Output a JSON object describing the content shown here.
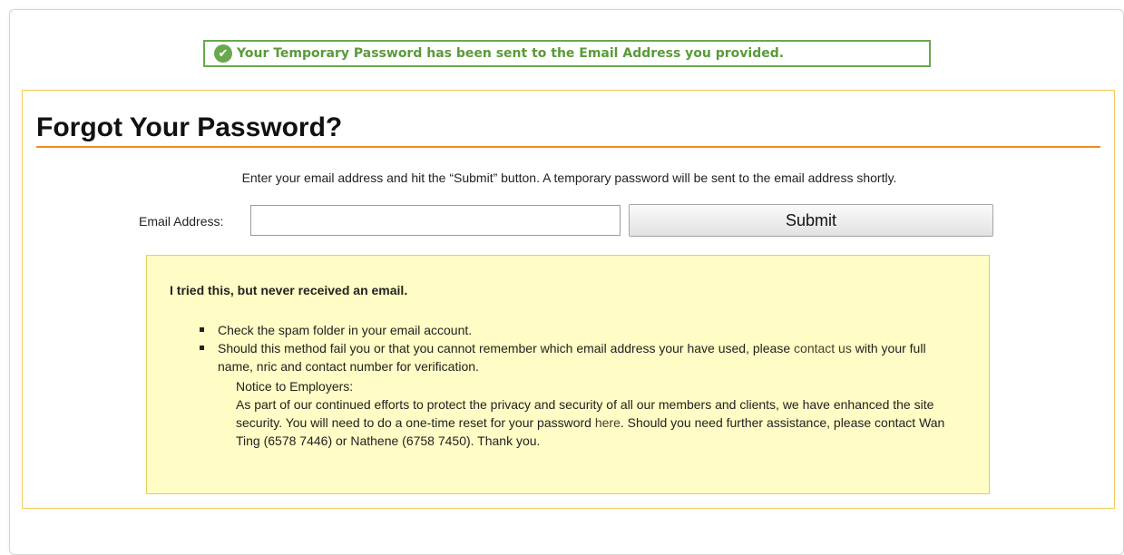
{
  "banner": {
    "icon": "check-circle-icon",
    "text": "Your Temporary Password has been sent to the Email Address you provided."
  },
  "page": {
    "title": "Forgot Your Password?",
    "instructions": "Enter your email address and hit the “Submit” button. A temporary password will be sent to the email address shortly."
  },
  "form": {
    "email_label": "Email Address:",
    "email_value": "",
    "submit_label": "Submit"
  },
  "help": {
    "title": "I tried this, but never received an email.",
    "bullet1": "Check the spam folder in your email account.",
    "bullet2_pre": "Should this method fail you or that you cannot remember which email address your have used, please",
    "bullet2_link": "contact us",
    "bullet2_post": "with your full name, nric and contact number for verification.",
    "notice_heading": "Notice to Employers:",
    "notice_pre": "As part of our continued efforts to protect the privacy and security of all our members and clients, we have enhanced the site security. You will need to do a one-time reset for your password",
    "notice_link": "here",
    "notice_post": ". Should you need further assistance, please contact Wan Ting (6578 7446) or Nathene (6758 7450). Thank you."
  },
  "colors": {
    "success_green": "#6aa84f",
    "accent_orange": "#f08a1c",
    "panel_border": "#f4c85a",
    "help_background": "#fffcc5"
  }
}
